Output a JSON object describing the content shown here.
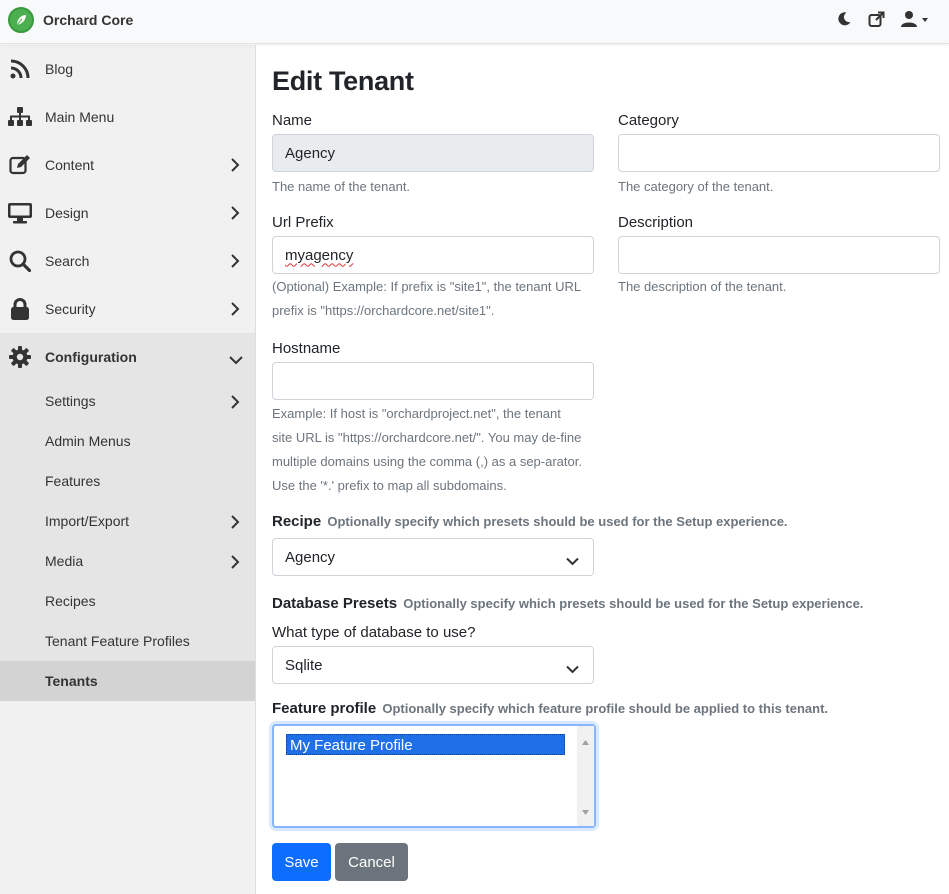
{
  "app": {
    "title": "Orchard Core"
  },
  "sidebar": {
    "items": [
      {
        "label": "Blog",
        "icon": "rss-icon"
      },
      {
        "label": "Main Menu",
        "icon": "sitemap-icon"
      },
      {
        "label": "Content",
        "icon": "edit-icon"
      },
      {
        "label": "Design",
        "icon": "desktop-icon"
      },
      {
        "label": "Search",
        "icon": "search-icon"
      },
      {
        "label": "Security",
        "icon": "lock-icon"
      },
      {
        "label": "Configuration",
        "icon": "gear-icon"
      }
    ],
    "configuration_sub": [
      {
        "label": "Settings"
      },
      {
        "label": "Admin Menus"
      },
      {
        "label": "Features"
      },
      {
        "label": "Import/Export"
      },
      {
        "label": "Media"
      },
      {
        "label": "Recipes"
      },
      {
        "label": "Tenant Feature Profiles"
      },
      {
        "label": "Tenants"
      }
    ]
  },
  "page": {
    "title": "Edit Tenant"
  },
  "form": {
    "name": {
      "label": "Name",
      "value": "Agency",
      "help": "The name of the tenant."
    },
    "category": {
      "label": "Category",
      "value": "",
      "help": "The category of the tenant."
    },
    "url_prefix": {
      "label": "Url Prefix",
      "value": "myagency",
      "help": "(Optional) Example: If prefix is \"site1\", the tenant URL prefix is \"https://orchardcore.net/site1\"."
    },
    "description": {
      "label": "Description",
      "value": "",
      "help": "The description of the tenant."
    },
    "hostname": {
      "label": "Hostname",
      "value": "",
      "help": "Example: If host is \"orchardproject.net\", the tenant site URL is \"https://orchardcore.net/\". You may de-fine multiple domains using the comma (,) as a sep-arator. Use the '*.' prefix to map all subdomains."
    },
    "recipe": {
      "label": "Recipe",
      "hint": "Optionally specify which presets should be used for the Setup experience.",
      "value": "Agency"
    },
    "database_presets": {
      "label": "Database Presets",
      "hint": "Optionally specify which presets should be used for the Setup experience."
    },
    "database_type": {
      "label": "What type of database to use?",
      "value": "Sqlite"
    },
    "feature_profile": {
      "label": "Feature profile",
      "hint": "Optionally specify which feature profile should be applied to this tenant.",
      "options": [
        "My Feature Profile"
      ]
    },
    "save_label": "Save",
    "cancel_label": "Cancel"
  },
  "colors": {
    "primary": "#0d6efd",
    "secondary": "#6c757d",
    "brand": "#4caf50"
  }
}
